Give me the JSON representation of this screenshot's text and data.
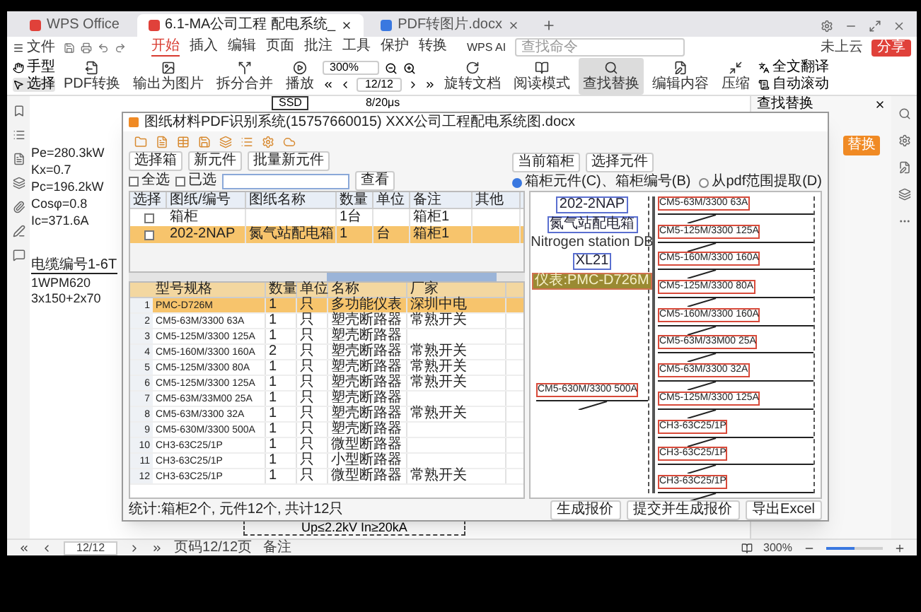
{
  "tabs": [
    {
      "label": "WPS Office",
      "kind": "home",
      "selected": false,
      "closable": false
    },
    {
      "label": "6.1-MA公司工程 配电系统_",
      "kind": "pdf",
      "selected": true,
      "closable": true
    },
    {
      "label": "PDF转图片.docx",
      "kind": "doc",
      "selected": false,
      "closable": true
    }
  ],
  "file_menu": "文件",
  "menu_tabs": [
    {
      "label": "开始",
      "selected": true
    },
    {
      "label": "插入",
      "selected": false
    },
    {
      "label": "编辑",
      "selected": false
    },
    {
      "label": "页面",
      "selected": false
    },
    {
      "label": "批注",
      "selected": false
    },
    {
      "label": "工具",
      "selected": false
    },
    {
      "label": "保护",
      "selected": false
    },
    {
      "label": "转换",
      "selected": false
    }
  ],
  "ai_label": "WPS AI",
  "command_search": {
    "placeholder": "查找命令"
  },
  "cloud_label": "未上云",
  "share_button": "分享",
  "toolbar": {
    "hand": "手型",
    "select": "选择",
    "buttons": [
      {
        "label": "PDF转换",
        "active": false
      },
      {
        "label": "输出为图片",
        "active": false
      },
      {
        "label": "拆分合并",
        "active": false
      },
      {
        "label": "播放",
        "active": false
      }
    ],
    "zoom": "300%",
    "page": "12/12",
    "view_buttons": [
      {
        "label": "旋转文档",
        "active": false
      },
      {
        "label": "阅读模式",
        "active": false
      },
      {
        "label": "查找替换",
        "active": true
      },
      {
        "label": "编辑内容",
        "active": false
      },
      {
        "label": "压缩",
        "active": false
      }
    ],
    "small_buttons": [
      "全文翻译",
      "自动滚动"
    ]
  },
  "document": {
    "top_labels": [
      "SSD",
      "8/20μs"
    ],
    "left_lines": [
      "Pe=280.3kW",
      "Kx=0.7",
      "Pc=196.2kW",
      "Cosφ=0.8",
      "Ic=371.6A"
    ],
    "cable_lines": [
      "电缆编号1-6T",
      "1WPM620",
      "3x150+2x70"
    ],
    "bottom_label": "Up≤2.2kV In≥20kA"
  },
  "side_panel": {
    "title": "查找替换",
    "action": "替换"
  },
  "dialog": {
    "title": "图纸材料PDF识别系统(15757660015)  XXX公司工程配电系统图.docx",
    "buttons": [
      "选择箱",
      "新元件",
      "批量新元件"
    ],
    "checkboxes": [
      {
        "label": "全选",
        "checked": false
      },
      {
        "label": "已选",
        "checked": false
      }
    ],
    "search_button": "查看",
    "panel_buttons": [
      "当前箱柜",
      "选择元件"
    ],
    "radios": [
      {
        "label": "箱柜元件(C)、箱柜编号(B)",
        "selected": true
      },
      {
        "label": "从pdf范围提取(D)",
        "selected": false
      }
    ],
    "cabinets": {
      "columns": [
        "选择",
        "图纸/编号",
        "图纸名称",
        "数量",
        "单位",
        "备注",
        "其他"
      ],
      "rows": [
        {
          "cells": [
            "",
            "箱柜",
            "",
            "1台",
            "",
            "箱柜1",
            ""
          ],
          "checked": false,
          "selected": false
        },
        {
          "cells": [
            "",
            "202-2NAP",
            "氮气站配电箱",
            "1",
            "台",
            "箱柜1",
            ""
          ],
          "checked": false,
          "selected": true
        }
      ]
    },
    "components": {
      "columns": [
        "型号规格",
        "数量",
        "单位",
        "名称",
        "厂家"
      ],
      "rows": [
        {
          "index": "1",
          "cells": [
            "PMC-D726M",
            "1",
            "只",
            "多功能仪表",
            "深圳中电"
          ],
          "selected": true
        },
        {
          "index": "2",
          "cells": [
            "CM5-63M/3300 63A",
            "1",
            "只",
            "塑壳断路器",
            "常熟开关"
          ],
          "selected": false
        },
        {
          "index": "3",
          "cells": [
            "CM5-125M/3300 125A",
            "1",
            "只",
            "塑壳断路器",
            ""
          ],
          "selected": false
        },
        {
          "index": "4",
          "cells": [
            "CM5-160M/3300 160A",
            "2",
            "只",
            "塑壳断路器",
            "常熟开关"
          ],
          "selected": false
        },
        {
          "index": "5",
          "cells": [
            "CM5-125M/3300 80A",
            "1",
            "只",
            "塑壳断路器",
            "常熟开关"
          ],
          "selected": false
        },
        {
          "index": "6",
          "cells": [
            "CM5-125M/3300 125A",
            "1",
            "只",
            "塑壳断路器",
            "常熟开关"
          ],
          "selected": false
        },
        {
          "index": "7",
          "cells": [
            "CM5-63M/33M00 25A",
            "1",
            "只",
            "塑壳断路器",
            ""
          ],
          "selected": false
        },
        {
          "index": "8",
          "cells": [
            "CM5-63M/3300 32A",
            "1",
            "只",
            "塑壳断路器",
            "常熟开关"
          ],
          "selected": false
        },
        {
          "index": "9",
          "cells": [
            "CM5-630M/3300 500A",
            "1",
            "只",
            "塑壳断路器",
            ""
          ],
          "selected": false
        },
        {
          "index": "10",
          "cells": [
            "CH3-63C25/1P",
            "1",
            "只",
            "微型断路器",
            ""
          ],
          "selected": false
        },
        {
          "index": "11",
          "cells": [
            "CH3-63C25/1P",
            "1",
            "只",
            "小型断路器",
            ""
          ],
          "selected": false
        },
        {
          "index": "12",
          "cells": [
            "CH3-63C25/1P",
            "1",
            "只",
            "微型断路器",
            "常熟开关"
          ],
          "selected": false
        }
      ]
    },
    "drawing": {
      "title_block": [
        {
          "text": "202-2NAP",
          "kind": "tag"
        },
        {
          "text": "氮气站配电箱",
          "kind": "tag"
        },
        {
          "text": "Nitrogen station DB",
          "kind": "plain"
        },
        {
          "text": "XL21",
          "kind": "tag"
        },
        {
          "text": "仪表:PMC-D726M",
          "kind": "meter"
        }
      ],
      "main_breaker": "CM5-630M/3300 500A",
      "branches": [
        "CM5-63M/3300 63A",
        "CM5-125M/3300 125A",
        "CM5-160M/3300 160A",
        "CM5-125M/3300 80A",
        "CM5-160M/3300 160A",
        "CM5-63M/33M00 25A",
        "CM5-63M/3300 32A",
        "CM5-125M/3300 125A",
        "CH3-63C25/1P",
        "CH3-63C25/1P",
        "CH3-63C25/1P"
      ]
    },
    "status": "统计:箱柜2个, 元件12个, 共计12只",
    "footer_buttons": [
      "生成报价",
      "提交并生成报价",
      "导出Excel"
    ]
  },
  "status_bar": {
    "page": "12/12",
    "page_info": "页码12/12页",
    "notes": "备注",
    "zoom": "300%",
    "zoom_slider": {
      "level": 0.5
    }
  }
}
